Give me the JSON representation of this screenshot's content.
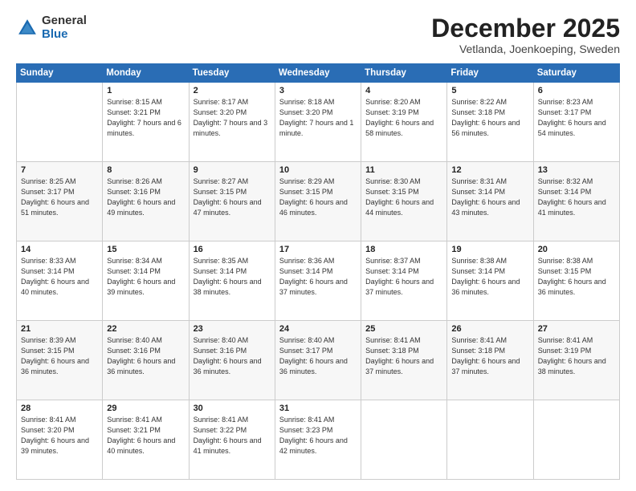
{
  "logo": {
    "general": "General",
    "blue": "Blue"
  },
  "header": {
    "month": "December 2025",
    "location": "Vetlanda, Joenkoeping, Sweden"
  },
  "days_of_week": [
    "Sunday",
    "Monday",
    "Tuesday",
    "Wednesday",
    "Thursday",
    "Friday",
    "Saturday"
  ],
  "weeks": [
    [
      {
        "day": "",
        "info": ""
      },
      {
        "day": "1",
        "info": "Sunrise: 8:15 AM\nSunset: 3:21 PM\nDaylight: 7 hours\nand 6 minutes."
      },
      {
        "day": "2",
        "info": "Sunrise: 8:17 AM\nSunset: 3:20 PM\nDaylight: 7 hours\nand 3 minutes."
      },
      {
        "day": "3",
        "info": "Sunrise: 8:18 AM\nSunset: 3:20 PM\nDaylight: 7 hours\nand 1 minute."
      },
      {
        "day": "4",
        "info": "Sunrise: 8:20 AM\nSunset: 3:19 PM\nDaylight: 6 hours\nand 58 minutes."
      },
      {
        "day": "5",
        "info": "Sunrise: 8:22 AM\nSunset: 3:18 PM\nDaylight: 6 hours\nand 56 minutes."
      },
      {
        "day": "6",
        "info": "Sunrise: 8:23 AM\nSunset: 3:17 PM\nDaylight: 6 hours\nand 54 minutes."
      }
    ],
    [
      {
        "day": "7",
        "info": "Sunrise: 8:25 AM\nSunset: 3:17 PM\nDaylight: 6 hours\nand 51 minutes."
      },
      {
        "day": "8",
        "info": "Sunrise: 8:26 AM\nSunset: 3:16 PM\nDaylight: 6 hours\nand 49 minutes."
      },
      {
        "day": "9",
        "info": "Sunrise: 8:27 AM\nSunset: 3:15 PM\nDaylight: 6 hours\nand 47 minutes."
      },
      {
        "day": "10",
        "info": "Sunrise: 8:29 AM\nSunset: 3:15 PM\nDaylight: 6 hours\nand 46 minutes."
      },
      {
        "day": "11",
        "info": "Sunrise: 8:30 AM\nSunset: 3:15 PM\nDaylight: 6 hours\nand 44 minutes."
      },
      {
        "day": "12",
        "info": "Sunrise: 8:31 AM\nSunset: 3:14 PM\nDaylight: 6 hours\nand 43 minutes."
      },
      {
        "day": "13",
        "info": "Sunrise: 8:32 AM\nSunset: 3:14 PM\nDaylight: 6 hours\nand 41 minutes."
      }
    ],
    [
      {
        "day": "14",
        "info": "Sunrise: 8:33 AM\nSunset: 3:14 PM\nDaylight: 6 hours\nand 40 minutes."
      },
      {
        "day": "15",
        "info": "Sunrise: 8:34 AM\nSunset: 3:14 PM\nDaylight: 6 hours\nand 39 minutes."
      },
      {
        "day": "16",
        "info": "Sunrise: 8:35 AM\nSunset: 3:14 PM\nDaylight: 6 hours\nand 38 minutes."
      },
      {
        "day": "17",
        "info": "Sunrise: 8:36 AM\nSunset: 3:14 PM\nDaylight: 6 hours\nand 37 minutes."
      },
      {
        "day": "18",
        "info": "Sunrise: 8:37 AM\nSunset: 3:14 PM\nDaylight: 6 hours\nand 37 minutes."
      },
      {
        "day": "19",
        "info": "Sunrise: 8:38 AM\nSunset: 3:14 PM\nDaylight: 6 hours\nand 36 minutes."
      },
      {
        "day": "20",
        "info": "Sunrise: 8:38 AM\nSunset: 3:15 PM\nDaylight: 6 hours\nand 36 minutes."
      }
    ],
    [
      {
        "day": "21",
        "info": "Sunrise: 8:39 AM\nSunset: 3:15 PM\nDaylight: 6 hours\nand 36 minutes."
      },
      {
        "day": "22",
        "info": "Sunrise: 8:40 AM\nSunset: 3:16 PM\nDaylight: 6 hours\nand 36 minutes."
      },
      {
        "day": "23",
        "info": "Sunrise: 8:40 AM\nSunset: 3:16 PM\nDaylight: 6 hours\nand 36 minutes."
      },
      {
        "day": "24",
        "info": "Sunrise: 8:40 AM\nSunset: 3:17 PM\nDaylight: 6 hours\nand 36 minutes."
      },
      {
        "day": "25",
        "info": "Sunrise: 8:41 AM\nSunset: 3:18 PM\nDaylight: 6 hours\nand 37 minutes."
      },
      {
        "day": "26",
        "info": "Sunrise: 8:41 AM\nSunset: 3:18 PM\nDaylight: 6 hours\nand 37 minutes."
      },
      {
        "day": "27",
        "info": "Sunrise: 8:41 AM\nSunset: 3:19 PM\nDaylight: 6 hours\nand 38 minutes."
      }
    ],
    [
      {
        "day": "28",
        "info": "Sunrise: 8:41 AM\nSunset: 3:20 PM\nDaylight: 6 hours\nand 39 minutes."
      },
      {
        "day": "29",
        "info": "Sunrise: 8:41 AM\nSunset: 3:21 PM\nDaylight: 6 hours\nand 40 minutes."
      },
      {
        "day": "30",
        "info": "Sunrise: 8:41 AM\nSunset: 3:22 PM\nDaylight: 6 hours\nand 41 minutes."
      },
      {
        "day": "31",
        "info": "Sunrise: 8:41 AM\nSunset: 3:23 PM\nDaylight: 6 hours\nand 42 minutes."
      },
      {
        "day": "",
        "info": ""
      },
      {
        "day": "",
        "info": ""
      },
      {
        "day": "",
        "info": ""
      }
    ]
  ]
}
